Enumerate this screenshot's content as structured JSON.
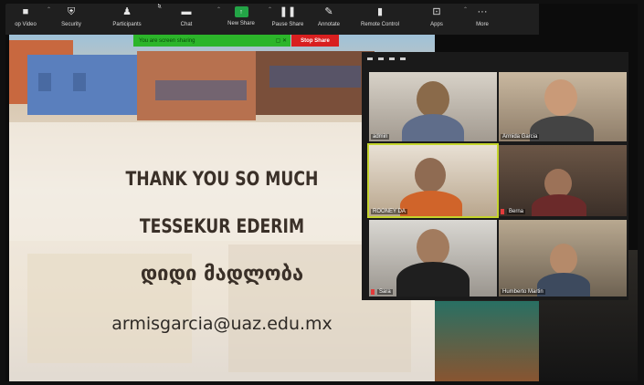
{
  "toolbar": {
    "items": [
      {
        "label": "op Video",
        "icon": "video-camera-icon"
      },
      {
        "label": "Security",
        "icon": "shield-icon"
      },
      {
        "label": "Participants",
        "icon": "participants-icon",
        "badge": "5"
      },
      {
        "label": "Chat",
        "icon": "chat-bubble-icon"
      },
      {
        "label": "New Share",
        "icon": "share-screen-icon"
      },
      {
        "label": "Pause Share",
        "icon": "pause-icon"
      },
      {
        "label": "Annotate",
        "icon": "pen-icon"
      },
      {
        "label": "Remote Control",
        "icon": "mouse-icon"
      },
      {
        "label": "Apps",
        "icon": "apps-icon"
      },
      {
        "label": "More",
        "icon": "more-icon"
      }
    ]
  },
  "share_bar": {
    "status": "You are screen sharing",
    "stop_label": "Stop Share"
  },
  "slide": {
    "line1": "THANK YOU SO MUCH",
    "line2": "TESSEKUR EDERIM",
    "line3": "დიდი მადლობა",
    "email": "armisgarcia@uaz.edu.mx"
  },
  "gallery": {
    "participants": [
      {
        "name": "admin",
        "muted": false
      },
      {
        "name": "Armida Garcia",
        "muted": false
      },
      {
        "name": "ROONEY DA",
        "muted": true
      },
      {
        "name": "Berna",
        "muted": true
      },
      {
        "name": "Sara",
        "muted": true
      },
      {
        "name": "Humberto Martin",
        "muted": false
      }
    ]
  },
  "colors": {
    "toolbar_bg": "#1f1f1f",
    "share_green": "#2cb52a",
    "stop_red": "#d91f1f",
    "active_speaker": "#c4d42c"
  }
}
